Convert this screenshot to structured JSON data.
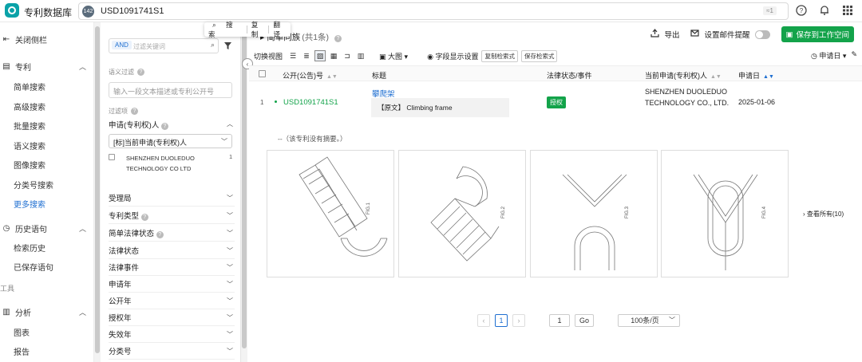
{
  "app": {
    "brand": "专利数据库"
  },
  "search": {
    "count_badge": "142",
    "query": "USD1091741S1",
    "scope_tag": "≈1"
  },
  "topbar_icons": [
    "help-icon",
    "bell-icon",
    "apps-grid-icon"
  ],
  "popover": {
    "search": "搜索",
    "copy": "复制",
    "translate": "翻译"
  },
  "leftnav": {
    "collapse": "关闭侧栏",
    "patent": "专利",
    "patent_items": [
      "简单搜索",
      "高级搜索",
      "批量搜索",
      "语义搜索",
      "图像搜索",
      "分类号搜索",
      "更多搜索"
    ],
    "active_item": "更多搜索",
    "history": "历史语句",
    "history_items": [
      "检索历史",
      "已保存语句"
    ],
    "tools_section": "工具",
    "analysis": "分析",
    "analysis_items": [
      "图表",
      "报告"
    ]
  },
  "filter": {
    "and_tag": "AND",
    "keyword_placeholder": "过滤关键词",
    "semantic_label": "语义过滤",
    "semantic_placeholder": "输入一段文本描述或专利公开号",
    "filter_items_label": "过滤项",
    "applicant_section": "申请(专利权)人",
    "applicant_select": "[标]当前申请(专利权)人",
    "applicant_option": "SHENZHEN DUOLEDUO TECHNOLOGY CO LTD",
    "applicant_option_count": "1",
    "sections": [
      "受理局",
      "专利类型",
      "简单法律状态",
      "法律状态",
      "法律事件",
      "申请年",
      "公开年",
      "授权年",
      "失效年",
      "分类号"
    ]
  },
  "main": {
    "title_prefix": "简单同族",
    "title_count": "(共1条)",
    "export": "导出",
    "email_alert": "设置邮件提醒",
    "save_to_workspace": "保存到工作空间",
    "switch_view": "切换视图",
    "image_size": "大图",
    "field_settings": "字段显示设置",
    "copy_query": "复制检索式",
    "save_query": "保存检索式",
    "sort_by": "申请日",
    "columns": [
      "公开(公告)号",
      "标题",
      "法律状态/事件",
      "当前申请(专利权)人",
      "申请日"
    ],
    "row": {
      "index": "1",
      "pub_no": "USD1091741S1",
      "title": "攀爬架",
      "original_tag": "【原文】",
      "original_title": "Climbing frame",
      "status": "授权",
      "applicant": "SHENZHEN DUOLEDUO TECHNOLOGY CO., LTD.",
      "date": "2025-01-06",
      "abstract": "--（该专利没有摘要。）"
    },
    "figure_labels": [
      "FIG.1",
      "FIG.2",
      "FIG.3",
      "FIG.4"
    ],
    "view_all": "查看所有(10)"
  },
  "pagination": {
    "prev": "‹",
    "current": "1",
    "next": "›",
    "goto_value": "1",
    "go": "Go",
    "page_size": "100条/页"
  },
  "colors": {
    "accent": "#1f6fd1",
    "success": "#13a34a",
    "brand": "#0aa2a8"
  }
}
